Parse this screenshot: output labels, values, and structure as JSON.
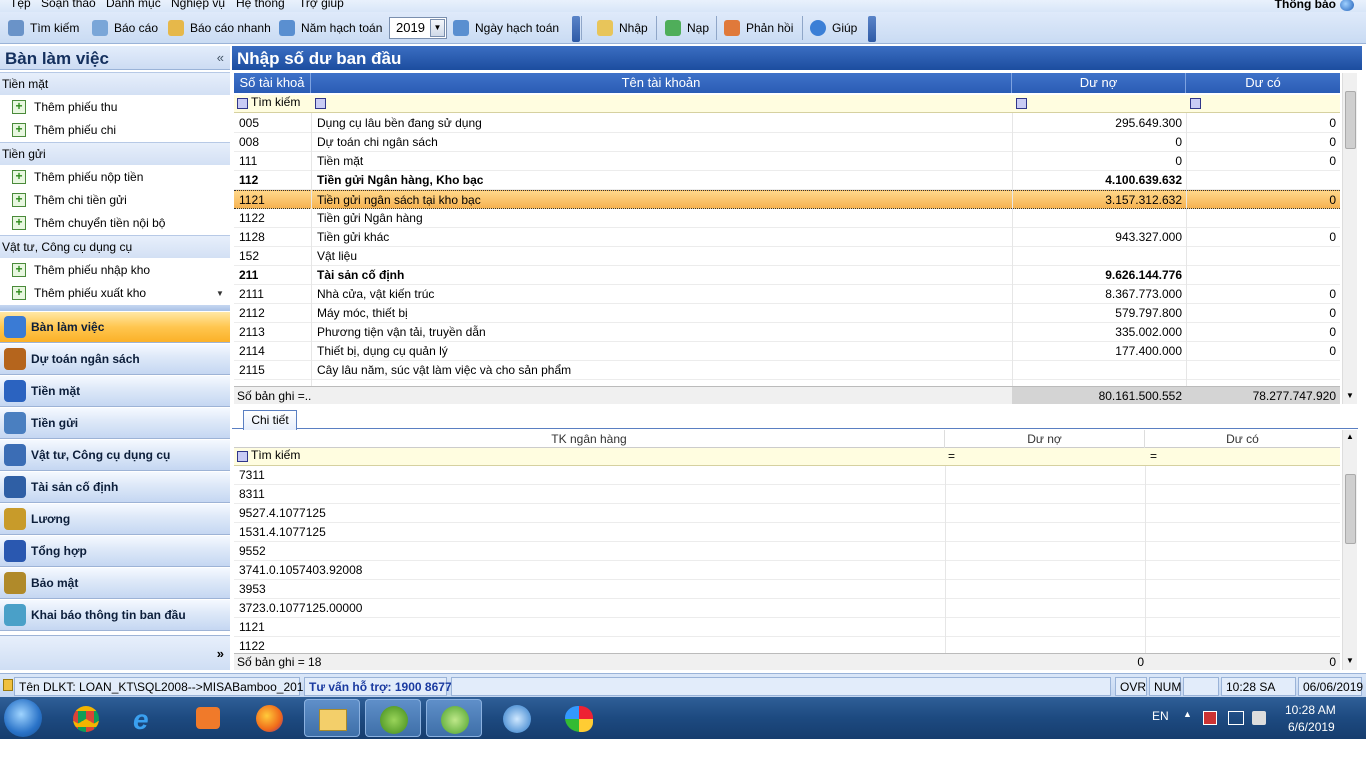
{
  "menu": [
    "Tệp",
    "Soạn thảo",
    "Danh mục",
    "Nghiệp vụ",
    "Hệ thống",
    "Trợ giúp"
  ],
  "notification_label": "Thông báo",
  "toolbar": {
    "search": "Tìm kiếm",
    "report": "Báo cáo",
    "quick_report": "Báo cáo nhanh",
    "fiscal_year_label": "Năm hạch toán",
    "fiscal_year_value": "2019",
    "posting_date": "Ngày hạch toán",
    "import": "Nhập",
    "reload": "Nạp",
    "feedback": "Phản hồi",
    "help": "Giúp"
  },
  "sidebar": {
    "title": "Bàn làm việc",
    "collapse_glyph": "«",
    "groups": [
      {
        "label": "Tiền mặt",
        "items": [
          "Thêm phiếu thu",
          "Thêm phiếu chi"
        ]
      },
      {
        "label": "Tiền gửi",
        "items": [
          "Thêm phiếu nộp tiền",
          "Thêm chi tiền gửi",
          "Thêm chuyển tiền nội bộ"
        ]
      },
      {
        "label": "Vật tư, Công cụ dụng cụ",
        "items": [
          "Thêm phiếu nhập kho",
          "Thêm phiếu xuất kho"
        ]
      }
    ],
    "nav": [
      {
        "label": "Bàn làm việc",
        "color": "#3a7bd5"
      },
      {
        "label": "Dự toán ngân sách",
        "color": "#b5651d"
      },
      {
        "label": "Tiền mặt",
        "color": "#2b63c0"
      },
      {
        "label": "Tiền gửi",
        "color": "#4a7fc0"
      },
      {
        "label": "Vật tư, Công cụ dụng cụ",
        "color": "#3b6db5"
      },
      {
        "label": "Tài sản cố định",
        "color": "#2f5fa5"
      },
      {
        "label": "Lương",
        "color": "#c89b2a"
      },
      {
        "label": "Tổng hợp",
        "color": "#2a58b0"
      },
      {
        "label": "Bảo mật",
        "color": "#b08a2a"
      },
      {
        "label": "Khai báo thông tin ban đầu",
        "color": "#4aa0c8"
      }
    ],
    "more_glyph": "»"
  },
  "main": {
    "title": "Nhập số dư ban đầu",
    "columns": [
      "Số tài khoả",
      "Tên tài khoản",
      "Dư nợ",
      "Dư có"
    ],
    "filter_placeholder": "Tìm kiếm",
    "rows": [
      {
        "code": "005",
        "name": "Dụng cụ lâu bền đang sử dụng",
        "debit": "295.649.300",
        "credit": "0",
        "bold": false
      },
      {
        "code": "008",
        "name": "Dự toán chi ngân sách",
        "debit": "0",
        "credit": "0",
        "bold": false
      },
      {
        "code": "111",
        "name": "Tiền mặt",
        "debit": "0",
        "credit": "0",
        "bold": false
      },
      {
        "code": "112",
        "name": "Tiền gửi Ngân hàng, Kho bạc",
        "debit": "4.100.639.632",
        "credit": "",
        "bold": true
      },
      {
        "code": "1121",
        "name": "Tiền gửi ngân sách tại kho bạc",
        "debit": "3.157.312.632",
        "credit": "0",
        "bold": false,
        "selected": true
      },
      {
        "code": "1122",
        "name": "Tiền gửi Ngân hàng",
        "debit": "",
        "credit": "",
        "bold": false
      },
      {
        "code": "1128",
        "name": "Tiền gửi khác",
        "debit": "943.327.000",
        "credit": "0",
        "bold": false
      },
      {
        "code": "152",
        "name": "Vật liệu",
        "debit": "",
        "credit": "",
        "bold": false
      },
      {
        "code": "211",
        "name": "Tài sản cố định",
        "debit": "9.626.144.776",
        "credit": "",
        "bold": true
      },
      {
        "code": "2111",
        "name": "Nhà cửa, vật kiến trúc",
        "debit": "8.367.773.000",
        "credit": "0",
        "bold": false
      },
      {
        "code": "2112",
        "name": "Máy móc, thiết bị",
        "debit": "579.797.800",
        "credit": "0",
        "bold": false
      },
      {
        "code": "2113",
        "name": "Phương tiện vận tải, truyền dẫn",
        "debit": "335.002.000",
        "credit": "0",
        "bold": false
      },
      {
        "code": "2114",
        "name": "Thiết bị, dụng cụ quản lý",
        "debit": "177.400.000",
        "credit": "0",
        "bold": false
      },
      {
        "code": "2115",
        "name": "Cây lâu năm, súc vật làm việc và cho sản phẩm",
        "debit": "",
        "credit": "",
        "bold": false
      }
    ],
    "footer": {
      "count_label": "Số bản ghi =..",
      "debit_total": "80.161.500.552",
      "credit_total": "78.277.747.920"
    }
  },
  "detail": {
    "tab_label": "Chi tiết",
    "columns": [
      "TK ngân hàng",
      "Dư nợ",
      "Dư có"
    ],
    "filter_placeholder": "Tìm kiếm",
    "filter_eq": "=",
    "rows": [
      "7311",
      "8311",
      "9527.4.1077125",
      "1531.4.1077125",
      "9552",
      "3741.0.1057403.92008",
      "3953",
      "3723.0.1077125.00000",
      "1121",
      "1122"
    ],
    "footer": {
      "count_label": "Số bản ghi = 18",
      "debit_total": "0",
      "credit_total": "0"
    }
  },
  "status": {
    "db": "Tên DLKT: LOAN_KT\\SQL2008-->MISABamboo_2019.",
    "support": "Tư vấn hỗ trợ: 1900 8677",
    "ovr": "OVR",
    "num": "NUM",
    "time": "10:28 SA",
    "date": "06/06/2019"
  },
  "taskbar": {
    "apps": [
      "chrome-icon",
      "ie-icon",
      "media-icon",
      "firefox-icon",
      "file-explorer-icon",
      "misa-icon",
      "bamboo-icon",
      "remote-desktop-icon",
      "paint-icon"
    ],
    "lang": "EN",
    "clock_time": "10:28 AM",
    "clock_date": "6/6/2019"
  }
}
